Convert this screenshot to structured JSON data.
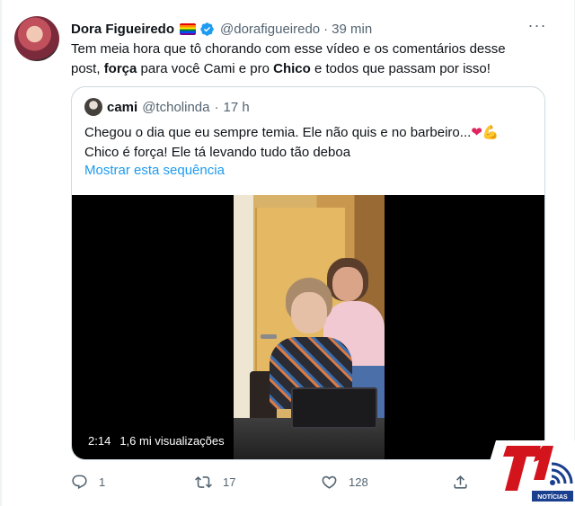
{
  "tweet": {
    "author_name": "Dora Figueiredo",
    "author_handle": "@dorafigueiredo",
    "separator": "·",
    "time": "39 min",
    "more_label": "···",
    "text_part1": "Tem meia hora que tô chorando com esse vídeo e os comentários desse post, ",
    "text_bold1": "força",
    "text_part2": " para você Cami e pro ",
    "text_bold2": "Chico",
    "text_part3": " e todos que passam por isso!"
  },
  "quote": {
    "author_name": "cami",
    "author_handle": "@tcholinda",
    "separator": "·",
    "time": "17 h",
    "line1": "Chegou o dia que eu sempre temia. Ele não quis e no barbeiro...",
    "emoji1": "❤",
    "emoji2": "💪",
    "line2": "Chico é força! Ele tá levando tudo tão deboa",
    "show_thread_link": "Mostrar esta sequência",
    "video": {
      "duration": "2:14",
      "views": "1,6 mi visualizações"
    }
  },
  "actions": {
    "reply_count": "1",
    "retweet_count": "17",
    "like_count": "128"
  },
  "watermark": {
    "logo_text": "T1",
    "sub_text": "NOTÍCIAS"
  },
  "colors": {
    "accent": "#1d9bf0",
    "muted": "#536471",
    "logo_red": "#d3141c",
    "logo_blue": "#1a3f8f"
  }
}
